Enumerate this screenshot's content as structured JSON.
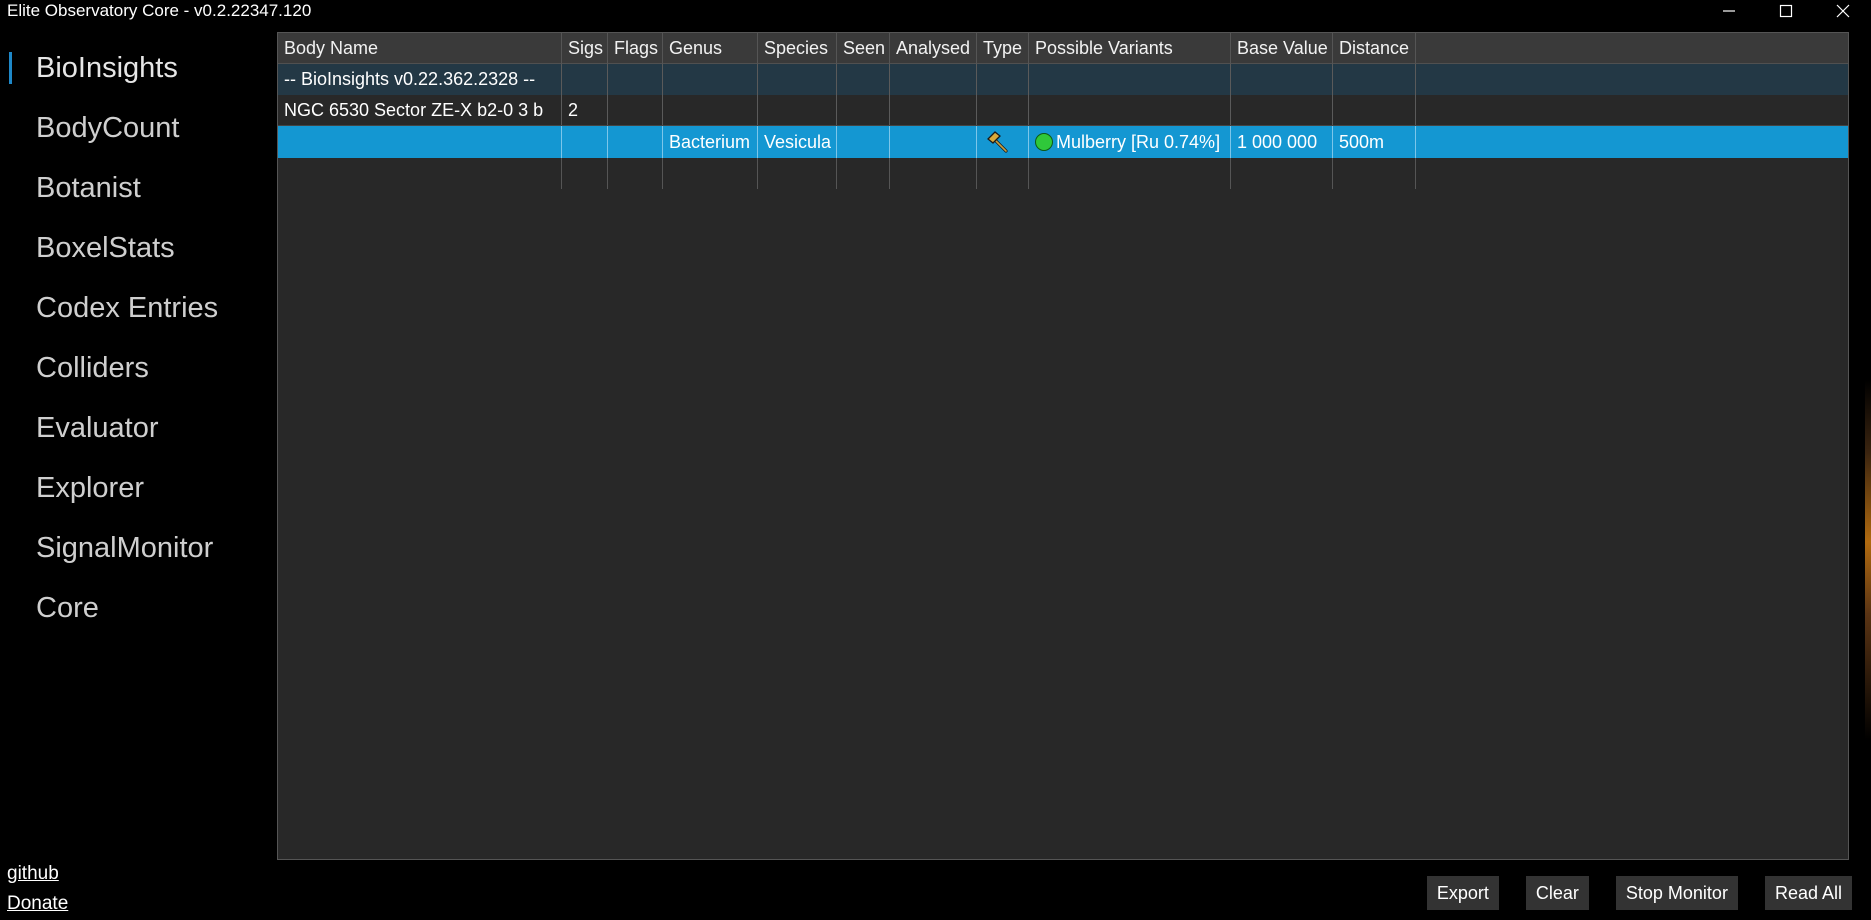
{
  "window": {
    "title": "Elite Observatory Core - v0.2.22347.120"
  },
  "sidebar": {
    "items": [
      {
        "label": "BioInsights",
        "active": true
      },
      {
        "label": "BodyCount"
      },
      {
        "label": "Botanist"
      },
      {
        "label": "BoxelStats"
      },
      {
        "label": "Codex Entries"
      },
      {
        "label": "Colliders"
      },
      {
        "label": "Evaluator"
      },
      {
        "label": "Explorer"
      },
      {
        "label": "SignalMonitor"
      },
      {
        "label": "Core"
      }
    ]
  },
  "footer": {
    "github": "github",
    "donate": "Donate"
  },
  "grid": {
    "columns": [
      "Body Name",
      "Sigs",
      "Flags",
      "Genus",
      "Species",
      "Seen",
      "Analysed",
      "Type",
      "Possible Variants",
      "Base Value",
      "Distance"
    ],
    "header_row": {
      "body_name": "-- BioInsights v0.22.362.2328  --"
    },
    "body_row": {
      "body_name": "NGC 6530 Sector ZE-X b2-0 3 b",
      "sigs": "2"
    },
    "selected_row": {
      "genus": "Bacterium",
      "species": "Vesicula",
      "type_icon": "hammer-icon",
      "variant": "Mulberry [Ru 0.74%]",
      "variant_color": "#2fc83a",
      "base_value": "1 000 000",
      "distance": "500m"
    }
  },
  "actions": {
    "export": "Export",
    "clear": "Clear",
    "stop_monitor": "Stop Monitor",
    "read_all": "Read All"
  },
  "colors": {
    "selection": "#1497d2",
    "accent": "#1e88c8"
  }
}
